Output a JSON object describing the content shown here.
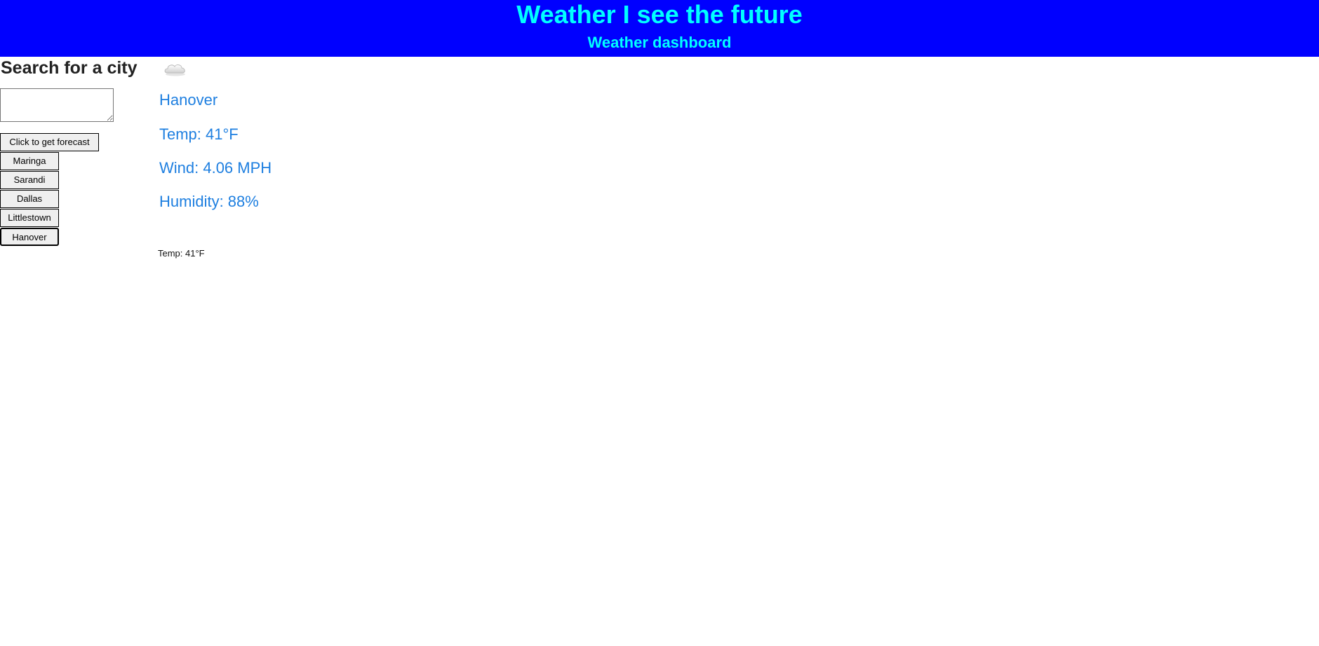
{
  "header": {
    "title": "Weather I see the future",
    "subtitle": "Weather dashboard"
  },
  "sidebar": {
    "heading": "Search for a city",
    "search_value": "",
    "forecast_button_label": "Click to get forecast",
    "cities": [
      {
        "label": "Maringa",
        "active": false
      },
      {
        "label": "Sarandi",
        "active": false
      },
      {
        "label": "Dallas",
        "active": false
      },
      {
        "label": "Littlestown",
        "active": false
      },
      {
        "label": "Hanover",
        "active": true
      }
    ]
  },
  "current": {
    "icon": "cloud-icon",
    "city": "Hanover",
    "temp": "Temp: 41°F",
    "wind": "Wind: 4.06 MPH",
    "humidity": "Humidity: 88%"
  },
  "forecast": {
    "temp": "Temp: 41°F"
  },
  "colors": {
    "header_bg": "#0000ff",
    "header_text": "#00ffff",
    "current_text": "#1e7fe0"
  }
}
